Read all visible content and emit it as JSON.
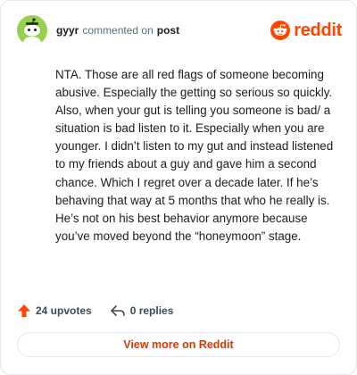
{
  "header": {
    "username": "gyyr",
    "commented_on_text": "commented on",
    "post_link": "post",
    "brand": "reddit"
  },
  "comment": {
    "text": "NTA. Those are all red flags of someone becoming abusive. Especially the getting so serious so quickly. Also, when your gut is telling you someone is bad/ a situation is bad listen to it. Especially when you are younger. I didn’t listen to my gut and instead listened to my friends about a guy and gave him a second chance. Which I regret over a decade later. If he’s behaving that way at 5 months that who he really is. He’s not on his best behavior anymore because you’ve moved beyond the “honeymoon” stage."
  },
  "actions": {
    "upvotes": "24 upvotes",
    "replies": "0 replies"
  },
  "cta": {
    "label": "View more on Reddit"
  },
  "colors": {
    "brand": "#ff4500",
    "cta_text": "#d93900",
    "avatar_bg": "#96d24d"
  },
  "icons": [
    "avatar-snoo",
    "reddit-logo-icon",
    "upvote-arrow-icon",
    "reply-arrow-icon"
  ]
}
